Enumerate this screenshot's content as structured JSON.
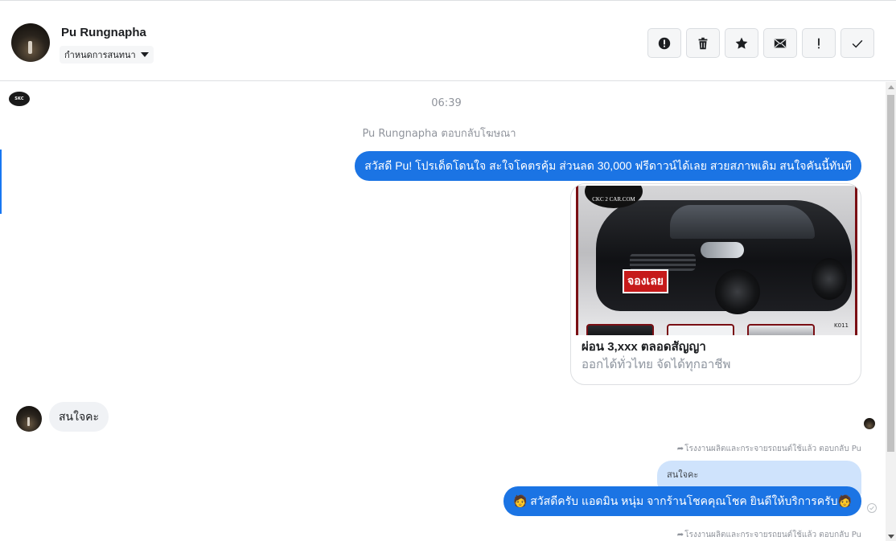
{
  "header": {
    "contact_name": "Pu Rungnapha",
    "assign_label": "กำหนดการสนทนา",
    "actions": [
      {
        "name": "spam",
        "icon": "alert-circle-icon"
      },
      {
        "name": "delete",
        "icon": "trash-icon"
      },
      {
        "name": "star",
        "icon": "star-icon"
      },
      {
        "name": "mark-unread",
        "icon": "envelope-icon"
      },
      {
        "name": "follow-up",
        "icon": "exclamation-icon"
      },
      {
        "name": "done",
        "icon": "checkmark-icon"
      }
    ]
  },
  "conversation": {
    "time": "06:39",
    "system_note": "Pu Rungnapha ตอบกลับโฆษณา",
    "page_logo_text": "SKC",
    "messages": {
      "outgoing_1": "สวัสดี Pu! โปรเด็ดโดนใจ สะใจโคตรคุ้ม ส่วนลด 30,000 ฟรีดาวน์ได้เลย สวยสภาพเดิม สนใจคันนี้ทันที",
      "incoming_1": "สนใจคะ",
      "reply_note": "โรงงานผลิตและกระจายรถยนต์ใช้แล้ว ตอบกลับ Pu",
      "quoted": "สนใจคะ",
      "outgoing_2": "🧑 สวัสดีครับ แอดมิน หนุ่ม จากร้านโชคคุณโชค ยินดีให้บริการครับ🧑",
      "reply_note_2": "โรงงานผลิตและกระจายรถยนต์ใช้แล้ว ตอบกลับ Pu"
    },
    "ad_card": {
      "brand": "CKC 2 CAR.COM",
      "promo_tag": "จองเลย",
      "code": "K011",
      "title": "ผ่อน 3,xxx ตลอดสัญญา",
      "subtitle": "ออกได้ทั่วไทย จัดได้ทุกอาชีพ"
    }
  },
  "colors": {
    "accent": "#1b74e4",
    "quoted_bg": "#cfe3fc",
    "incoming_bg": "#f0f2f5"
  }
}
